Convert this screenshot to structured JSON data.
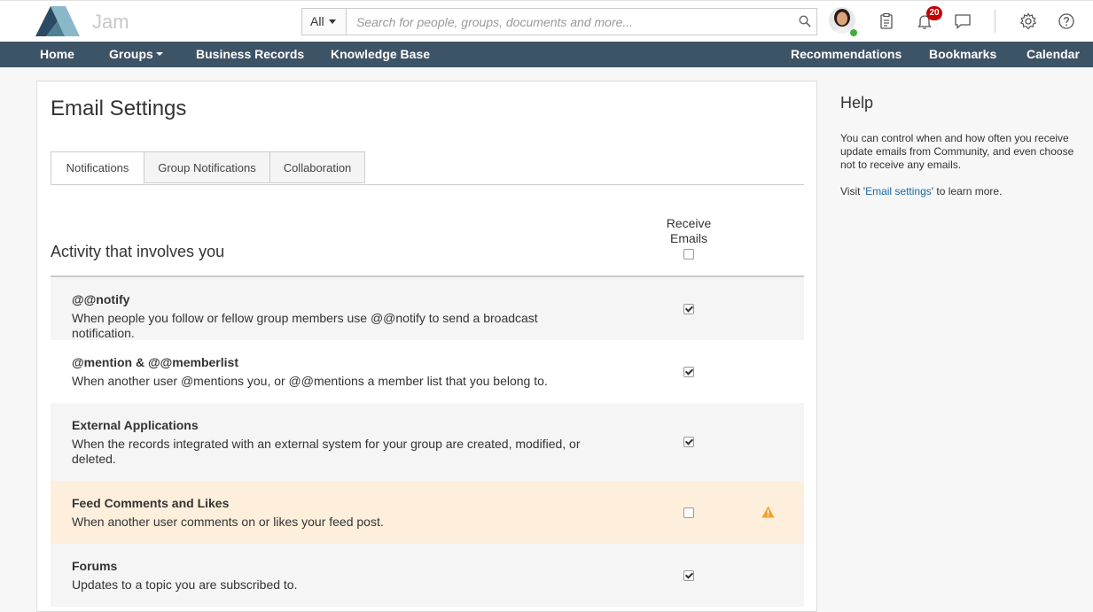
{
  "header": {
    "brand": "Jam",
    "search_scope": "All",
    "search_placeholder": "Search for people, groups, documents and more...",
    "notification_count": "20"
  },
  "nav": {
    "home": "Home",
    "groups": "Groups",
    "business_records": "Business Records",
    "knowledge_base": "Knowledge Base",
    "recommendations": "Recommendations",
    "bookmarks": "Bookmarks",
    "calendar": "Calendar"
  },
  "main": {
    "title": "Email Settings",
    "tabs": [
      {
        "label": "Notifications",
        "active": true
      },
      {
        "label": "Group Notifications",
        "active": false
      },
      {
        "label": "Collaboration",
        "active": false
      }
    ],
    "section_title": "Activity that involves you",
    "column_header": "Receive Emails",
    "rows": [
      {
        "title": "@@notify",
        "desc": "When people you follow or fellow group members use @@notify to send a broadcast notification.",
        "checked": true
      },
      {
        "title": "@mention & @@memberlist",
        "desc": "When another user @mentions you, or @@mentions a member list that you belong to.",
        "checked": true
      },
      {
        "title": "External Applications",
        "desc": "When the records integrated with an external system for your group are created, modified, or deleted.",
        "checked": true
      },
      {
        "title": "Feed Comments and Likes",
        "desc": "When another user comments on or likes your feed post.",
        "checked": false,
        "warning": true
      },
      {
        "title": "Forums",
        "desc": "Updates to a topic you are subscribed to.",
        "checked": true
      }
    ]
  },
  "help": {
    "title": "Help",
    "text": "You can control when and how often you receive update emails from Community, and even choose not to receive any emails.",
    "visit_prefix": "Visit '",
    "link_label": "Email settings",
    "visit_suffix": "' to learn more."
  },
  "colors": {
    "nav_bg": "#3d5366",
    "warn_row_bg": "#fdefdc",
    "badge_bg": "#c40000",
    "warning_icon": "#f0a030",
    "link": "#1a6aa8"
  },
  "icons": [
    "jam-logo",
    "search-icon",
    "tasks-icon",
    "bell-icon",
    "chat-icon",
    "gear-icon",
    "help-icon",
    "warning-icon"
  ]
}
